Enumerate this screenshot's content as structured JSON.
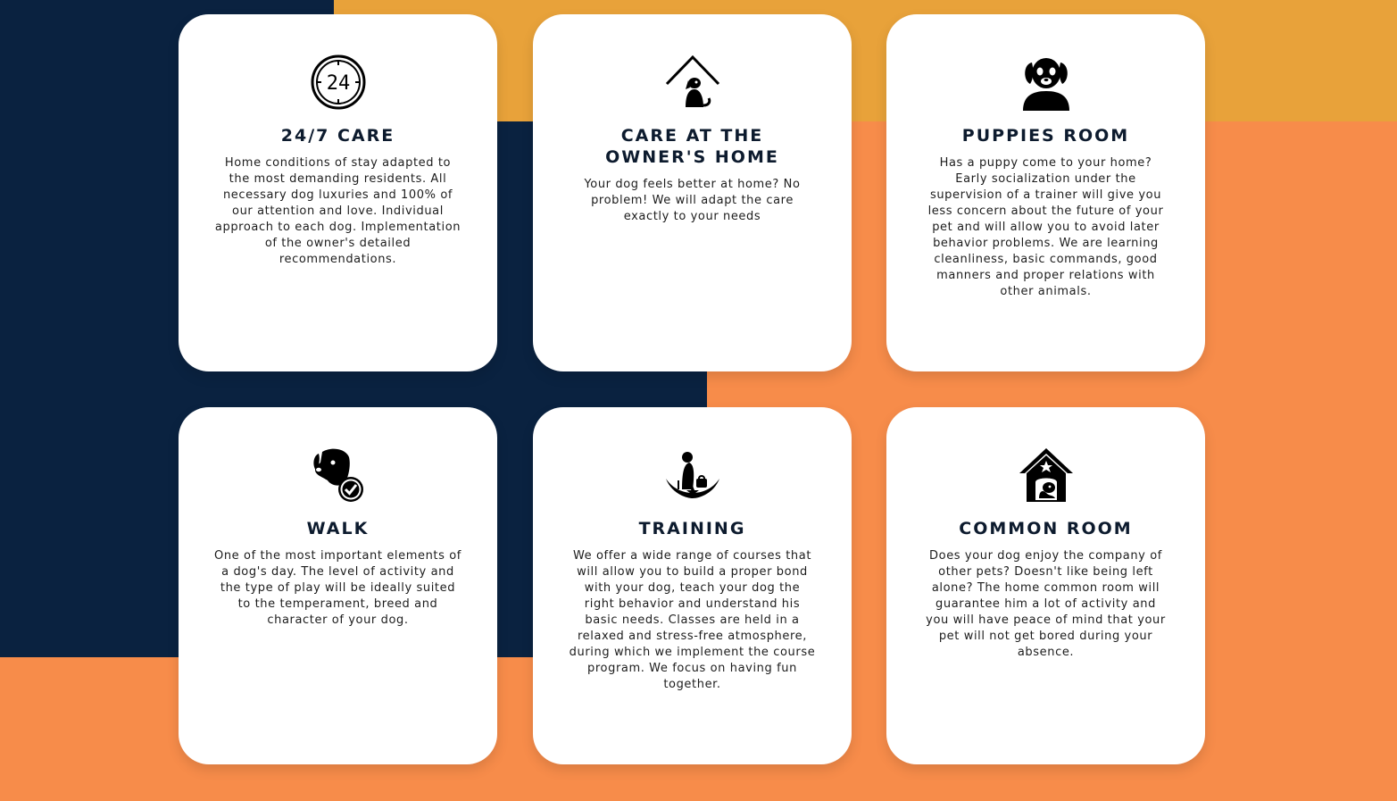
{
  "colors": {
    "navy": "#0a2240",
    "gold": "#e8a23a",
    "orange": "#f78c4a",
    "card": "#ffffff",
    "title": "#0d1b2e"
  },
  "cards": [
    {
      "icon": "clock-24-icon",
      "title": "24/7 CARE",
      "text": "Home conditions of stay adapted to the most demanding residents. All necessary dog luxuries and 100% of our attention and love. Individual approach to each dog. Implementation of the owner's detailed recommendations."
    },
    {
      "icon": "house-dog-icon",
      "title": "CARE AT THE OWNER'S HOME",
      "text": "Your dog feels better at home? No problem! We will adapt the care exactly to your needs"
    },
    {
      "icon": "puppy-face-icon",
      "title": "PUPPIES ROOM",
      "text": "Has a puppy come to your home? Early socialization under the supervision of a trainer will give you less concern about the future of your pet and will allow you to avoid later behavior problems. We are learning cleanliness, basic commands, good manners and proper relations with other animals."
    },
    {
      "icon": "dog-check-icon",
      "title": "WALK",
      "text": "One of the most important elements of a dog's day. The level of activity and the type of play will be ideally suited to the temperament, breed and character of your dog."
    },
    {
      "icon": "dog-training-icon",
      "title": "TRAINING",
      "text": "We offer a wide range of courses that will allow you to build a proper bond with your dog, teach your dog the right behavior and understand his basic needs. Classes are held in a relaxed and stress-free atmosphere, during which we implement the course program. We focus on having fun together."
    },
    {
      "icon": "dog-house-star-icon",
      "title": "COMMON ROOM",
      "text": "Does your dog enjoy the company of other pets? Doesn't like being left alone? The home common room will guarantee him a lot of activity and you will have peace of mind that your pet will not get bored during your absence."
    }
  ]
}
